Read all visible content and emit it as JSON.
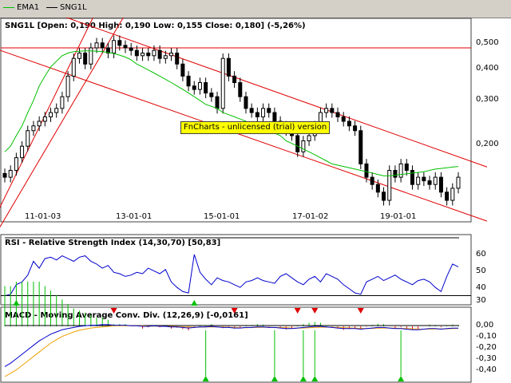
{
  "legend": {
    "ema_label": "EMA1",
    "ema_color": "#00c000",
    "sym_label": "SNG1L",
    "sym_color": "#000000"
  },
  "price_panel": {
    "header": "SNG1L [Open: 0,190  High: 0,190  Low: 0,155  Close: 0,180] (-5,26%)",
    "y_ticks": [
      "0,500",
      "0,400",
      "0,300",
      "0,200"
    ],
    "x_ticks": [
      "11-01-03",
      "13-01-01",
      "15-01-01",
      "17-01-02",
      "19-01-01"
    ]
  },
  "rsi_panel": {
    "header": "RSI - Relative Strength Index (14,30,70) [50,83]",
    "y_ticks": [
      "60",
      "50",
      "40",
      "30"
    ]
  },
  "macd_panel": {
    "header": "MACD - Moving Average Conv. Div. (12,26,9) [-0,0161]",
    "y_ticks": [
      "0,00",
      "-0,10",
      "-0,20",
      "-0,30",
      "-0,40"
    ]
  },
  "watermark": "FnCharts - unlicensed (trial) version",
  "colors": {
    "up": "#ffffff",
    "down": "#000000",
    "ema": "#00c000",
    "channel": "#e00000",
    "rsi": "#0000cc",
    "macd": "#0000cc",
    "signal": "#f0a000",
    "buy": "#00c000",
    "sell": "#e00000"
  },
  "chart_data": [
    {
      "type": "candlestick",
      "title": "SNG1L [Open: 0,190  High: 0,190  Low: 0,155  Close: 0,180] (-5,26%)",
      "y_scale": "log",
      "ylim": [
        0.14,
        0.56
      ],
      "x_ticks": [
        "11-01-03",
        "13-01-01",
        "15-01-01",
        "17-01-02",
        "19-01-01"
      ],
      "close": [
        0.18,
        0.19,
        0.21,
        0.23,
        0.26,
        0.27,
        0.28,
        0.29,
        0.3,
        0.31,
        0.34,
        0.4,
        0.46,
        0.48,
        0.44,
        0.5,
        0.52,
        0.5,
        0.48,
        0.53,
        0.51,
        0.5,
        0.49,
        0.47,
        0.48,
        0.47,
        0.49,
        0.46,
        0.47,
        0.48,
        0.44,
        0.4,
        0.37,
        0.36,
        0.38,
        0.35,
        0.34,
        0.31,
        0.46,
        0.4,
        0.38,
        0.34,
        0.31,
        0.3,
        0.29,
        0.31,
        0.3,
        0.28,
        0.27,
        0.26,
        0.25,
        0.22,
        0.24,
        0.25,
        0.27,
        0.3,
        0.31,
        0.3,
        0.29,
        0.28,
        0.27,
        0.26,
        0.2,
        0.18,
        0.17,
        0.16,
        0.15,
        0.19,
        0.18,
        0.2,
        0.19,
        0.17,
        0.18,
        0.175,
        0.17,
        0.18,
        0.16,
        0.15,
        0.165,
        0.18
      ],
      "ema": [
        0.22,
        0.23,
        0.25,
        0.27,
        0.3,
        0.33,
        0.37,
        0.4,
        0.43,
        0.45,
        0.47,
        0.48,
        0.485,
        0.487,
        0.488,
        0.488,
        0.487,
        0.485,
        0.482,
        0.478,
        0.472,
        0.465,
        0.455,
        0.44,
        0.43,
        0.42,
        0.41,
        0.4,
        0.39,
        0.38,
        0.37,
        0.36,
        0.35,
        0.34,
        0.33,
        0.32,
        0.315,
        0.31,
        0.3,
        0.295,
        0.29,
        0.285,
        0.28,
        0.275,
        0.27,
        0.265,
        0.26,
        0.255,
        0.25,
        0.24,
        0.235,
        0.23,
        0.225,
        0.22,
        0.215,
        0.21,
        0.205,
        0.2,
        0.198,
        0.196,
        0.194,
        0.192,
        0.19,
        0.188,
        0.186,
        0.184,
        0.182,
        0.182,
        0.183,
        0.184,
        0.185,
        0.186,
        0.187,
        0.188,
        0.19,
        0.192,
        0.193,
        0.194,
        0.195,
        0.196
      ]
    },
    {
      "type": "line",
      "title": "RSI - Relative Strength Index (14,30,70) [50,83]",
      "ylim": [
        28,
        64
      ],
      "y_ticks": [
        30,
        40,
        50,
        60
      ],
      "series": [
        {
          "values": [
            30,
            31,
            38,
            40,
            45,
            55,
            50,
            57,
            58,
            56,
            59,
            57,
            55,
            58,
            59,
            55,
            53,
            50,
            52,
            47,
            46,
            44,
            45,
            47,
            46,
            50,
            48,
            46,
            49,
            40,
            36,
            33,
            32,
            60,
            47,
            42,
            38,
            43,
            41,
            40,
            38,
            36,
            40,
            41,
            43,
            41,
            40,
            39,
            44,
            46,
            43,
            40,
            38,
            42,
            44,
            40,
            46,
            44,
            42,
            38,
            35,
            32,
            31,
            40,
            42,
            44,
            41,
            43,
            45,
            42,
            40,
            38,
            41,
            42,
            40,
            36,
            33,
            44,
            53,
            51
          ]
        }
      ]
    },
    {
      "type": "line",
      "title": "MACD - Moving Average Conv. Div. (12,26,9) [-0,0161]",
      "ylim": [
        -0.45,
        0.05
      ],
      "y_ticks": [
        0.0,
        -0.1,
        -0.2,
        -0.3,
        -0.4
      ],
      "series": [
        {
          "values": [
            -0.36,
            -0.33,
            -0.29,
            -0.25,
            -0.21,
            -0.17,
            -0.13,
            -0.1,
            -0.07,
            -0.05,
            -0.03,
            -0.02,
            -0.01,
            0.0,
            0.005,
            0.01,
            0.01,
            0.015,
            0.015,
            0.01,
            0.01,
            0.01,
            0.005,
            0.005,
            0.0,
            0.0,
            0.005,
            0.0,
            0.0,
            -0.005,
            -0.005,
            -0.01,
            -0.015,
            -0.01,
            -0.005,
            -0.005,
            0.0,
            -0.005,
            -0.01,
            -0.01,
            -0.015,
            -0.015,
            -0.01,
            -0.01,
            -0.005,
            -0.005,
            -0.01,
            -0.01,
            -0.015,
            -0.02,
            -0.02,
            -0.015,
            -0.01,
            -0.005,
            0.0,
            0.0,
            -0.005,
            -0.01,
            -0.015,
            -0.02,
            -0.02,
            -0.02,
            -0.025,
            -0.02,
            -0.015,
            -0.01,
            -0.01,
            -0.015,
            -0.02,
            -0.02,
            -0.025,
            -0.03,
            -0.03,
            -0.025,
            -0.02,
            -0.02,
            -0.025,
            -0.02,
            -0.016,
            -0.016
          ]
        },
        {
          "values": [
            -0.45,
            -0.42,
            -0.39,
            -0.35,
            -0.31,
            -0.27,
            -0.23,
            -0.19,
            -0.15,
            -0.12,
            -0.09,
            -0.07,
            -0.05,
            -0.035,
            -0.025,
            -0.015,
            -0.01,
            -0.005,
            0.0,
            0.005,
            0.005,
            0.005,
            0.005,
            0.005,
            0.005,
            0.002,
            0.002,
            0.002,
            0.0,
            0.0,
            -0.002,
            -0.004,
            -0.006,
            -0.008,
            -0.008,
            -0.006,
            -0.005,
            -0.005,
            -0.006,
            -0.008,
            -0.01,
            -0.012,
            -0.012,
            -0.011,
            -0.01,
            -0.009,
            -0.009,
            -0.01,
            -0.011,
            -0.013,
            -0.015,
            -0.016,
            -0.015,
            -0.013,
            -0.01,
            -0.008,
            -0.007,
            -0.008,
            -0.01,
            -0.012,
            -0.014,
            -0.016,
            -0.018,
            -0.019,
            -0.018,
            -0.016,
            -0.015,
            -0.015,
            -0.016,
            -0.018,
            -0.02,
            -0.022,
            -0.024,
            -0.025,
            -0.024,
            -0.023,
            -0.023,
            -0.022,
            -0.02,
            -0.018
          ]
        }
      ],
      "signals": {
        "sell_bars": [
          19,
          40,
          51,
          54,
          62
        ],
        "buy_bars": [
          35,
          47,
          52,
          54,
          69
        ]
      }
    }
  ]
}
